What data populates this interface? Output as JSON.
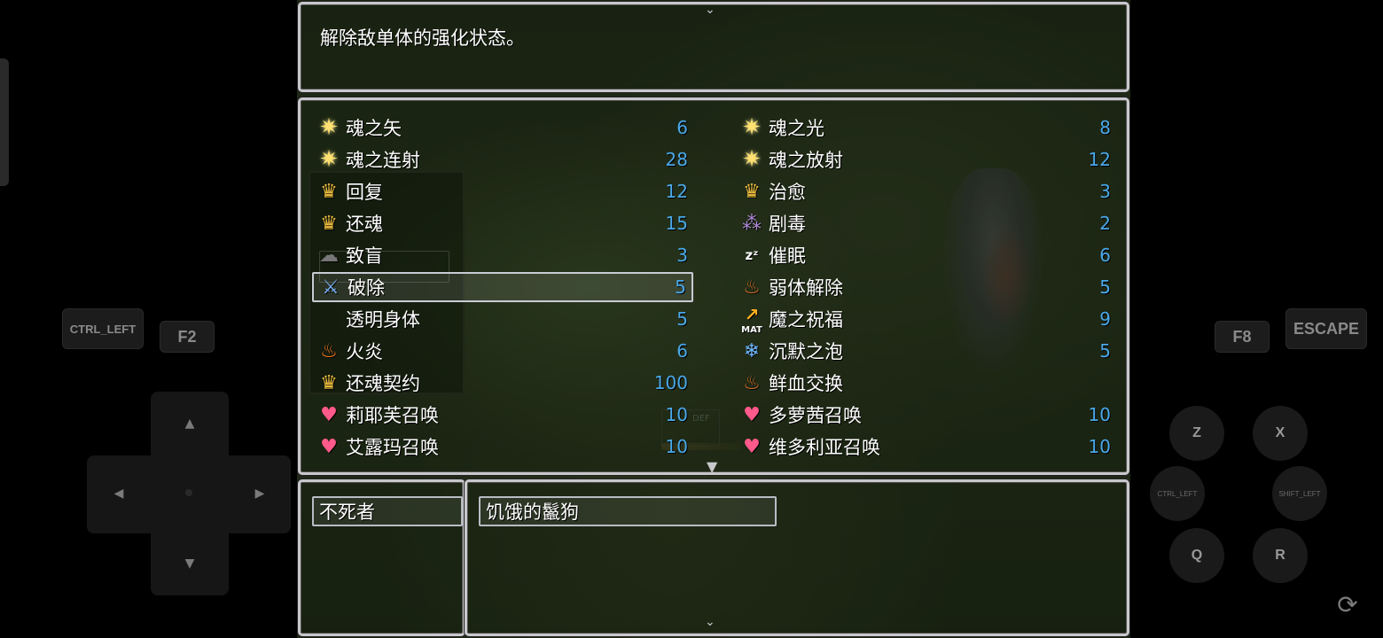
{
  "help": {
    "text": "解除敌单体的强化状态。"
  },
  "skills_left": [
    {
      "icon": "burst-icon",
      "glyph": "✷",
      "cls": "burst",
      "name": "魂之矢",
      "cost": "6"
    },
    {
      "icon": "burst-icon",
      "glyph": "✷",
      "cls": "burst",
      "name": "魂之连射",
      "cost": "28"
    },
    {
      "icon": "crown-icon",
      "glyph": "♛",
      "cls": "crown",
      "name": "回复",
      "cost": "12"
    },
    {
      "icon": "crown-icon",
      "glyph": "♛",
      "cls": "crown",
      "name": "还魂",
      "cost": "15"
    },
    {
      "icon": "blind-icon",
      "glyph": "☁",
      "cls": "blind",
      "name": "致盲",
      "cost": "3"
    },
    {
      "icon": "sword-icon",
      "glyph": "⚔",
      "cls": "sword",
      "name": "破除",
      "cost": "5"
    },
    {
      "icon": "",
      "glyph": "",
      "cls": "",
      "name": "透明身体",
      "cost": "5"
    },
    {
      "icon": "fire-icon",
      "glyph": "♨",
      "cls": "fire",
      "name": "火炎",
      "cost": "6"
    },
    {
      "icon": "crown-icon",
      "glyph": "♛",
      "cls": "crown",
      "name": "还魂契约",
      "cost": "100"
    },
    {
      "icon": "heart-icon",
      "glyph": "♥",
      "cls": "heart",
      "name": "莉耶芙召唤",
      "cost": "10"
    },
    {
      "icon": "heart-icon",
      "glyph": "♥",
      "cls": "heart",
      "name": "艾露玛召唤",
      "cost": "10"
    }
  ],
  "skills_right": [
    {
      "icon": "burst-icon",
      "glyph": "✷",
      "cls": "burst",
      "name": "魂之光",
      "cost": "8"
    },
    {
      "icon": "burst-icon",
      "glyph": "✷",
      "cls": "burst",
      "name": "魂之放射",
      "cost": "12"
    },
    {
      "icon": "crown-icon",
      "glyph": "♛",
      "cls": "crown",
      "name": "治愈",
      "cost": "3"
    },
    {
      "icon": "poison-icon",
      "glyph": "⁂",
      "cls": "poison",
      "name": "剧毒",
      "cost": "2"
    },
    {
      "icon": "sleep-icon",
      "glyph": "zᶻ",
      "cls": "zzz",
      "name": "催眠",
      "cost": "6"
    },
    {
      "icon": "flame-icon",
      "glyph": "♨",
      "cls": "flame",
      "name": "弱体解除",
      "cost": "5"
    },
    {
      "icon": "mat-up-icon",
      "glyph": "↗",
      "cls": "mat",
      "name": "魔之祝福",
      "cost": "9"
    },
    {
      "icon": "bubble-icon",
      "glyph": "❄",
      "cls": "bubble",
      "name": "沉默之泡",
      "cost": "5"
    },
    {
      "icon": "flame-icon",
      "glyph": "♨",
      "cls": "flame",
      "name": "鲜血交换",
      "cost": ""
    },
    {
      "icon": "heart-icon",
      "glyph": "♥",
      "cls": "heart",
      "name": "多萝茜召唤",
      "cost": "10"
    },
    {
      "icon": "heart-icon",
      "glyph": "♥",
      "cls": "heart",
      "name": "维多利亚召唤",
      "cost": "10"
    }
  ],
  "mat_label": "MAT",
  "ghost_def": "DEF",
  "actor": {
    "name": "不死者"
  },
  "enemy": {
    "name": "饥饿的鬣狗"
  },
  "controls": {
    "ctrl_left": "CTRL_LEFT",
    "f2": "F2",
    "f8": "F8",
    "escape": "ESCAPE",
    "z": "Z",
    "x": "X",
    "ctrl_left_small": "CTRL_LEFT",
    "shift_left_small": "SHIFT_LEFT",
    "q": "Q",
    "r": "R"
  },
  "colors": {
    "cost": "#4aa8e8",
    "window_border": "#c8c8cc"
  }
}
